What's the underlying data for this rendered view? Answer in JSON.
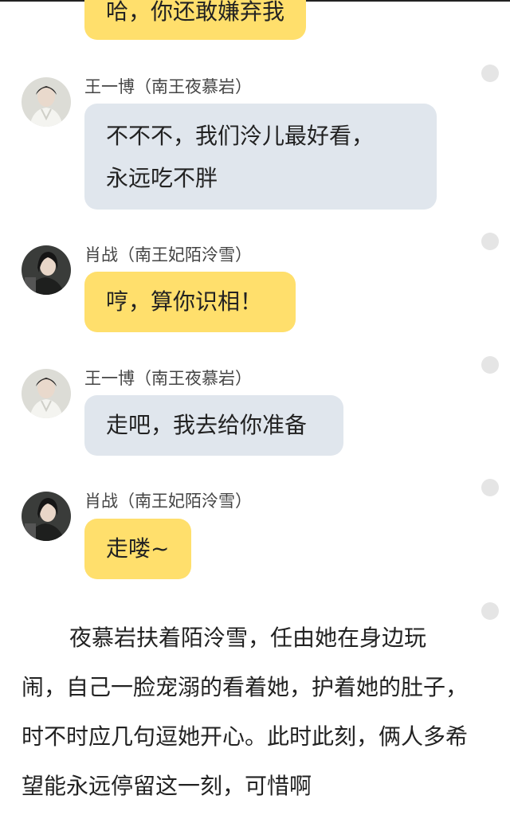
{
  "messages": [
    {
      "id": "m0",
      "sender": "",
      "text": "哈，你还敢嫌弃我",
      "lines": [
        "哈，你还敢嫌弃我"
      ],
      "side": "female"
    },
    {
      "id": "m1",
      "sender": "王一博（南王夜慕岩）",
      "text": "",
      "lines": [
        "不不不，我们泠儿最好看，",
        "永远吃不胖"
      ],
      "side": "male"
    },
    {
      "id": "m2",
      "sender": "肖战（南王妃陌泠雪）",
      "text": "哼，算你识相！",
      "lines": [
        "哼，算你识相！"
      ],
      "side": "female"
    },
    {
      "id": "m3",
      "sender": "王一博（南王夜慕岩）",
      "text": "走吧，我去给你准备",
      "lines": [
        "走吧，我去给你准备"
      ],
      "side": "male"
    },
    {
      "id": "m4",
      "sender": "肖战（南王妃陌泠雪）",
      "text": "走喽~",
      "lines": [
        "走喽~"
      ],
      "side": "female"
    }
  ],
  "narration": "夜慕岩扶着陌泠雪，任由她在身边玩闹，自己一脸宠溺的看着她，护着她的肚子，时不时应几句逗她开心。此时此刻，俩人多希望能永远停留这一刻，可惜啊",
  "colors": {
    "female_bubble": "#ffdf6c",
    "male_bubble": "#e0e6ed",
    "text": "#222222",
    "sender": "#444444",
    "dot": "#e5e5e5"
  },
  "icons": {
    "male_avatar": "avatar-man-icon",
    "female_avatar": "avatar-woman-icon",
    "dot": "dot-icon"
  }
}
